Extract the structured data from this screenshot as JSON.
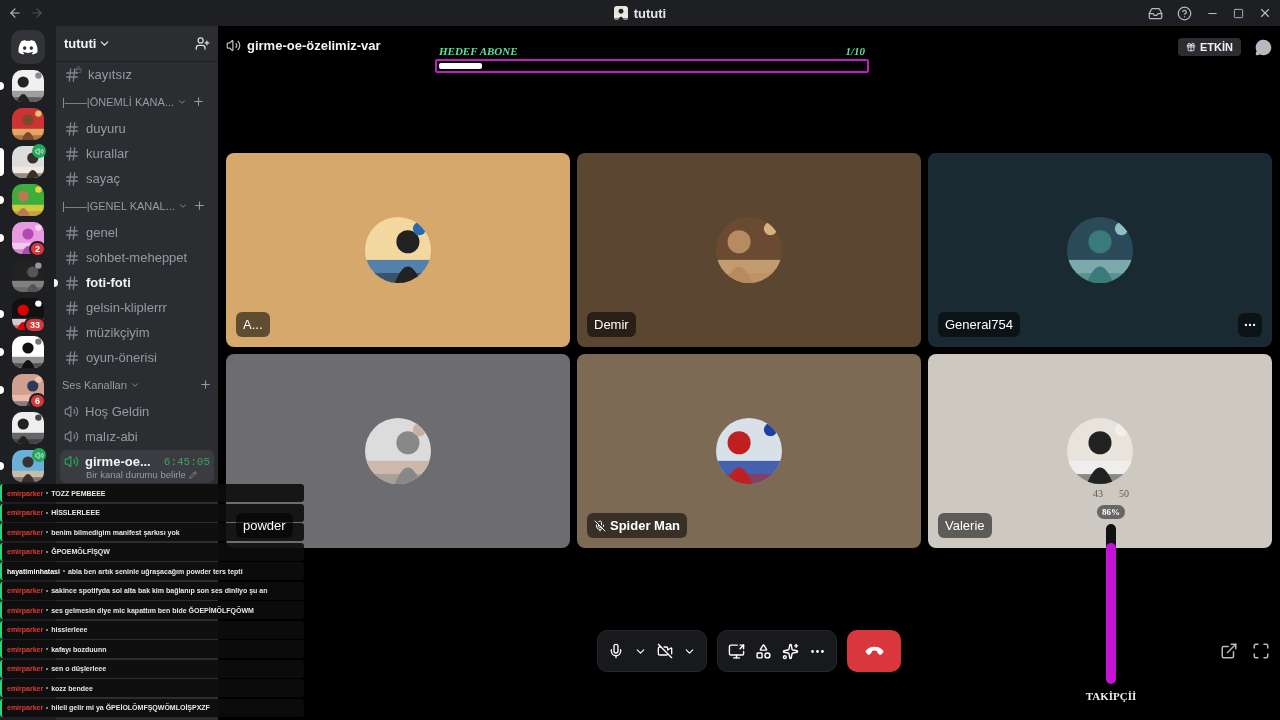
{
  "window": {
    "title": "tututi"
  },
  "servers": [
    {
      "selected": false,
      "unread": true,
      "speaker": false
    },
    {
      "selected": false,
      "unread": false,
      "speaker": false
    },
    {
      "selected": true,
      "unread": false,
      "speaker": true
    },
    {
      "selected": false,
      "unread": true,
      "speaker": false
    },
    {
      "selected": false,
      "unread": true,
      "speaker": false,
      "badge": "2"
    },
    {
      "selected": false,
      "unread": false,
      "speaker": false
    },
    {
      "selected": false,
      "unread": true,
      "speaker": false,
      "badge": "33"
    },
    {
      "selected": false,
      "unread": true,
      "speaker": false
    },
    {
      "selected": false,
      "unread": true,
      "speaker": false,
      "badge": "6"
    },
    {
      "selected": false,
      "unread": false,
      "speaker": false
    },
    {
      "selected": false,
      "unread": true,
      "speaker": true
    }
  ],
  "guild": {
    "name": "tututi"
  },
  "channels": [
    {
      "kind": "locked",
      "name": "kayıtsız",
      "unread": false
    },
    {
      "kind": "category",
      "name": "|——|ÖNEMLİ KANA..."
    },
    {
      "kind": "text",
      "name": "duyuru",
      "unread": false
    },
    {
      "kind": "text",
      "name": "kurallar",
      "unread": false
    },
    {
      "kind": "text",
      "name": "sayaç",
      "unread": false
    },
    {
      "kind": "category",
      "name": "|——|GENEL KANAL..."
    },
    {
      "kind": "text",
      "name": "genel",
      "unread": false
    },
    {
      "kind": "text",
      "name": "sohbet-meheppet",
      "unread": false
    },
    {
      "kind": "text",
      "name": "foti-foti",
      "unread": true
    },
    {
      "kind": "text",
      "name": "gelsin-kliplerrr",
      "unread": false
    },
    {
      "kind": "text",
      "name": "müzikçiyim",
      "unread": false
    },
    {
      "kind": "text",
      "name": "oyun-önerisi",
      "unread": false
    },
    {
      "kind": "voice-category",
      "name": "Ses Kanalları"
    },
    {
      "kind": "voice",
      "name": "Hoş Geldin"
    },
    {
      "kind": "voice",
      "name": "malız-abi"
    },
    {
      "kind": "voice-active",
      "name": "girme-oe...",
      "timer": "6:45:05",
      "status": "Bir kanal durumu belirle"
    }
  ],
  "call": {
    "channel": "girme-oe-özelimiz-var",
    "activity_button": "ETKİN"
  },
  "goal": {
    "title": "HEDEF ABONE",
    "count": "1/10",
    "level": 0.1
  },
  "tiles": [
    {
      "name": "A...",
      "color": "#d6a86c",
      "muted": false,
      "hovered": false
    },
    {
      "name": "Demir",
      "color": "#5b4631",
      "muted": false,
      "hovered": false
    },
    {
      "name": "General754",
      "color": "#1a2a33",
      "muted": false,
      "hovered": true
    },
    {
      "name": "powder",
      "color": "#6d6d71",
      "muted": false,
      "hovered": false
    },
    {
      "name": "Spider Man",
      "color": "#7c6a55",
      "muted": true,
      "hovered": false
    },
    {
      "name": "Valerie",
      "color": "#cdc9c1",
      "muted": false,
      "hovered": false
    }
  ],
  "follower_meter": {
    "numbers": [
      "43",
      "50"
    ],
    "percent": "86%",
    "level": 0.88,
    "label": "TAKİPÇİİ"
  },
  "chat": [
    {
      "author": "emirparker",
      "color": "#e03a34",
      "text": "TOZZ PEMBEEE"
    },
    {
      "author": "emirparker",
      "color": "#e03a34",
      "text": "HİSSLERLEEE"
    },
    {
      "author": "emirparker",
      "color": "#e03a34",
      "text": "benim bilmedigim manifest şarkısı yok"
    },
    {
      "author": "emirparker",
      "color": "#e03a34",
      "text": "ĞPOEMÖLFİŞQW"
    },
    {
      "author": "hayatiminhatasi",
      "color": "#ffffff",
      "text": "abla ben artık seninle uğraşacağım powder ters tepti"
    },
    {
      "author": "emirparker",
      "color": "#e03a34",
      "text": "sakince spotifyda sol alta bak kim bağlanıp son ses dinliyo şu an"
    },
    {
      "author": "emirparker",
      "color": "#e03a34",
      "text": "ses gelmesin diye mic kapattım ben bide ĞOEPİMÖLFQÖWM"
    },
    {
      "author": "emirparker",
      "color": "#e03a34",
      "text": "hisslerleee"
    },
    {
      "author": "emirparker",
      "color": "#e03a34",
      "text": "kafayı bozduunn"
    },
    {
      "author": "emirparker",
      "color": "#e03a34",
      "text": "sen o düşlerleee"
    },
    {
      "author": "emirparker",
      "color": "#e03a34",
      "text": "kozz bendee"
    },
    {
      "author": "emirparker",
      "color": "#e03a34",
      "text": "hileli gelir mi ya ĞPEİOLÖMFŞQWÖMLOİŞPXZF"
    }
  ]
}
